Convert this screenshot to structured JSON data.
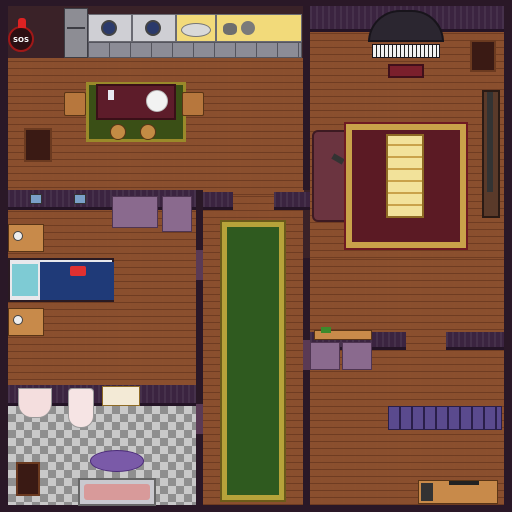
{
  "hud": {
    "sos_label": "SOS",
    "sos_icon": "bomb-sos-icon"
  },
  "piano": {
    "icon": "grand-piano-icon"
  },
  "bed": {
    "pillow_icon": "youtube-play-icon"
  },
  "colors": {
    "floor_wood": "#8a4f2e",
    "wall": "#3b2440",
    "rug_green": "#2f5a1f",
    "rug_red": "#5b1a24",
    "rug_trim": "#c9a24a",
    "counter_yellow": "#f2da7a",
    "blanket": "#1f3a78"
  }
}
